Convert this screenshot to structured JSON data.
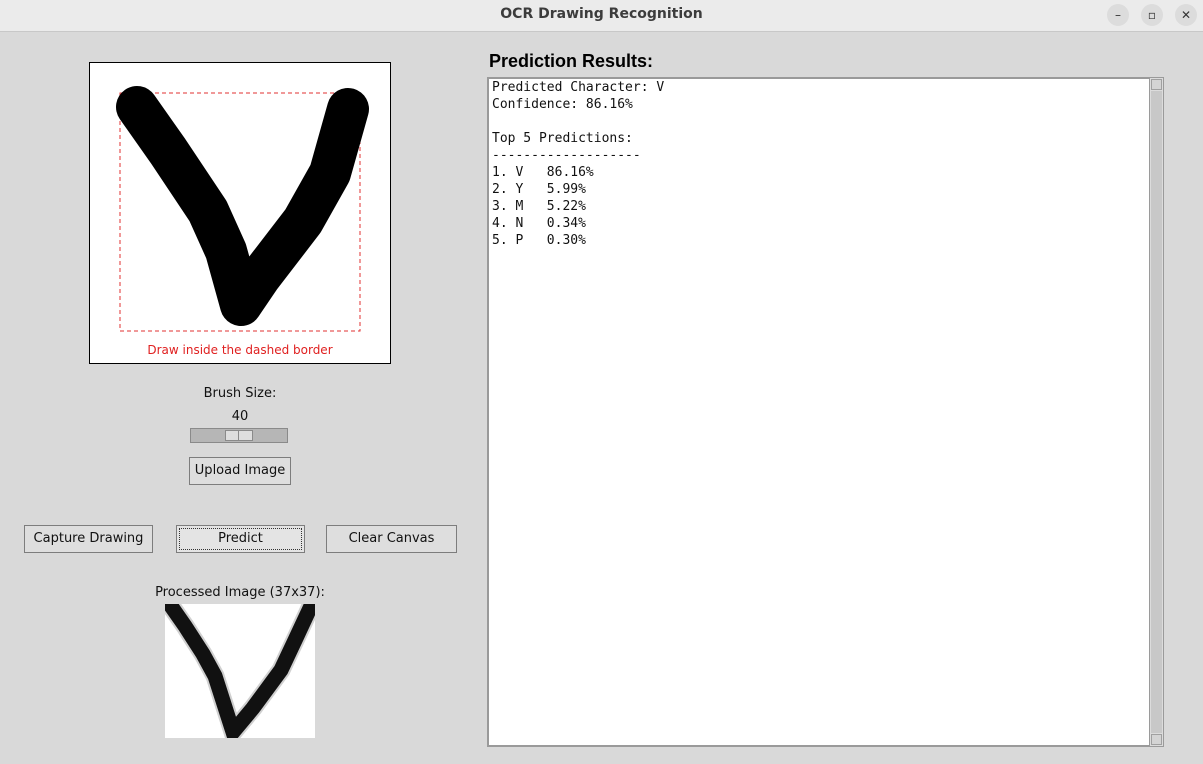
{
  "window": {
    "title": "OCR Drawing Recognition",
    "controls": [
      "–",
      "▫",
      "✕"
    ]
  },
  "canvas": {
    "hint": "Draw inside the dashed border",
    "hint_color": "#e02020",
    "drawn_character": "V"
  },
  "brush": {
    "label": "Brush Size:",
    "value": "40"
  },
  "buttons": {
    "upload": "Upload Image",
    "capture": "Capture Drawing",
    "predict": "Predict",
    "clear": "Clear Canvas"
  },
  "processed": {
    "label": "Processed Image (37x37):"
  },
  "results": {
    "title": "Prediction Results:",
    "predicted_line": "Predicted Character: V",
    "confidence_line": "Confidence: 86.16%",
    "top5_header": "Top 5 Predictions:",
    "separator": "-------------------",
    "items": [
      "1. V   86.16%",
      "2. Y   5.99%",
      "3. M   5.22%",
      "4. N   0.34%",
      "5. P   0.30%"
    ]
  }
}
